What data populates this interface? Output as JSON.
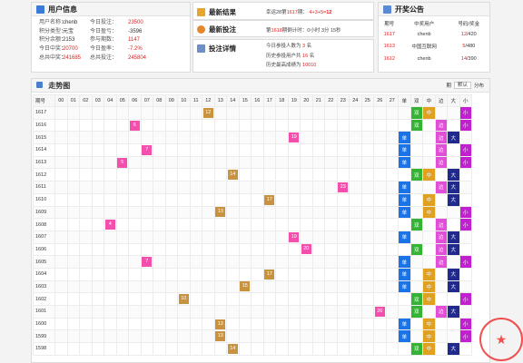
{
  "user_panel": {
    "title": "用户信息",
    "rows": [
      [
        "用户名称：",
        "chenb",
        "今日投注：",
        "23500"
      ],
      [
        "积分类型：",
        "元宝",
        "今日盈亏：",
        "-3596"
      ],
      [
        "积分余额：",
        "2153",
        "参与期数：",
        "1147"
      ],
      [
        "今日中奖：",
        "20700",
        "今日盈率：",
        "-7.2%"
      ],
      [
        "总共中奖：",
        "241685",
        "总共投注：",
        "245804"
      ]
    ]
  },
  "latest_result": {
    "title": "最新结果",
    "text_prefix": "幸运28第",
    "period": "1617",
    "text_mid": "期：",
    "expr": "4+3+5=",
    "sum": "12"
  },
  "latest_bet": {
    "title": "最新投注",
    "text_prefix": "第",
    "period": "1618",
    "text_suffix": "期倒计时：0小时 3分 15秒"
  },
  "bet_detail": {
    "title": "投注详情",
    "lines": [
      {
        "label": "今日参投人数为",
        "value": "3",
        "unit": "名"
      },
      {
        "label": "历史参投用户共",
        "value": "16",
        "unit": "名"
      },
      {
        "label": "历史最高成绩为",
        "value": "10010",
        "unit": ""
      }
    ]
  },
  "announcement": {
    "title": "开奖公告",
    "headers": [
      "期号",
      "中奖用户",
      "号码/奖金"
    ],
    "rows": [
      {
        "period": "1617",
        "user": "chenb",
        "num": "12",
        "prize": "/420"
      },
      {
        "period": "1613",
        "user": "中国互联网",
        "num": "5",
        "prize": "/480"
      },
      {
        "period": "1612",
        "user": "chenb",
        "num": "14",
        "prize": "/390"
      }
    ]
  },
  "trend": {
    "title": "走势图",
    "tools": {
      "count_label": "期",
      "select_value": "默认",
      "dist_label": "分布"
    },
    "headers": [
      "期号",
      "00",
      "01",
      "02",
      "03",
      "04",
      "05",
      "06",
      "07",
      "08",
      "09",
      "10",
      "11",
      "12",
      "13",
      "14",
      "15",
      "16",
      "17",
      "18",
      "19",
      "20",
      "21",
      "22",
      "23",
      "24",
      "25",
      "26",
      "27",
      "单",
      "双",
      "中",
      "边",
      "大",
      "小"
    ],
    "rows": [
      {
        "period": "1617",
        "num": 12,
        "odd": false,
        "mid": true,
        "big": false
      },
      {
        "period": "1616",
        "num": 6,
        "odd": false,
        "mid": false,
        "big": false
      },
      {
        "period": "1615",
        "num": 19,
        "odd": true,
        "mid": false,
        "big": true
      },
      {
        "period": "1614",
        "num": 7,
        "odd": true,
        "mid": false,
        "big": false
      },
      {
        "period": "1613",
        "num": 5,
        "odd": true,
        "mid": false,
        "big": false
      },
      {
        "period": "1612",
        "num": 14,
        "odd": false,
        "mid": true,
        "big": true
      },
      {
        "period": "1611",
        "num": 23,
        "odd": true,
        "mid": false,
        "big": true
      },
      {
        "period": "1610",
        "num": 17,
        "odd": true,
        "mid": true,
        "big": true
      },
      {
        "period": "1609",
        "num": 13,
        "odd": true,
        "mid": true,
        "big": false
      },
      {
        "period": "1608",
        "num": 4,
        "odd": false,
        "mid": false,
        "big": false
      },
      {
        "period": "1607",
        "num": 19,
        "odd": true,
        "mid": false,
        "big": true
      },
      {
        "period": "1606",
        "num": 20,
        "odd": false,
        "mid": false,
        "big": true
      },
      {
        "period": "1605",
        "num": 7,
        "odd": true,
        "mid": false,
        "big": false
      },
      {
        "period": "1604",
        "num": 17,
        "odd": true,
        "mid": true,
        "big": true
      },
      {
        "period": "1603",
        "num": 15,
        "odd": true,
        "mid": true,
        "big": true
      },
      {
        "period": "1602",
        "num": 10,
        "odd": false,
        "mid": true,
        "big": false
      },
      {
        "period": "1601",
        "num": 26,
        "odd": false,
        "mid": false,
        "big": true
      },
      {
        "period": "1600",
        "num": 13,
        "odd": true,
        "mid": true,
        "big": false
      },
      {
        "period": "1599",
        "num": 13,
        "odd": true,
        "mid": true,
        "big": false
      },
      {
        "period": "1598",
        "num": 14,
        "odd": false,
        "mid": true,
        "big": true
      }
    ],
    "labels": {
      "odd": "单",
      "even": "双",
      "mid": "中",
      "edge": "边",
      "big": "大",
      "small": "小"
    }
  },
  "colors": {
    "pink_ball": "#f54fae",
    "orange_ball": "#c8923f",
    "red_text": "#e02020"
  }
}
